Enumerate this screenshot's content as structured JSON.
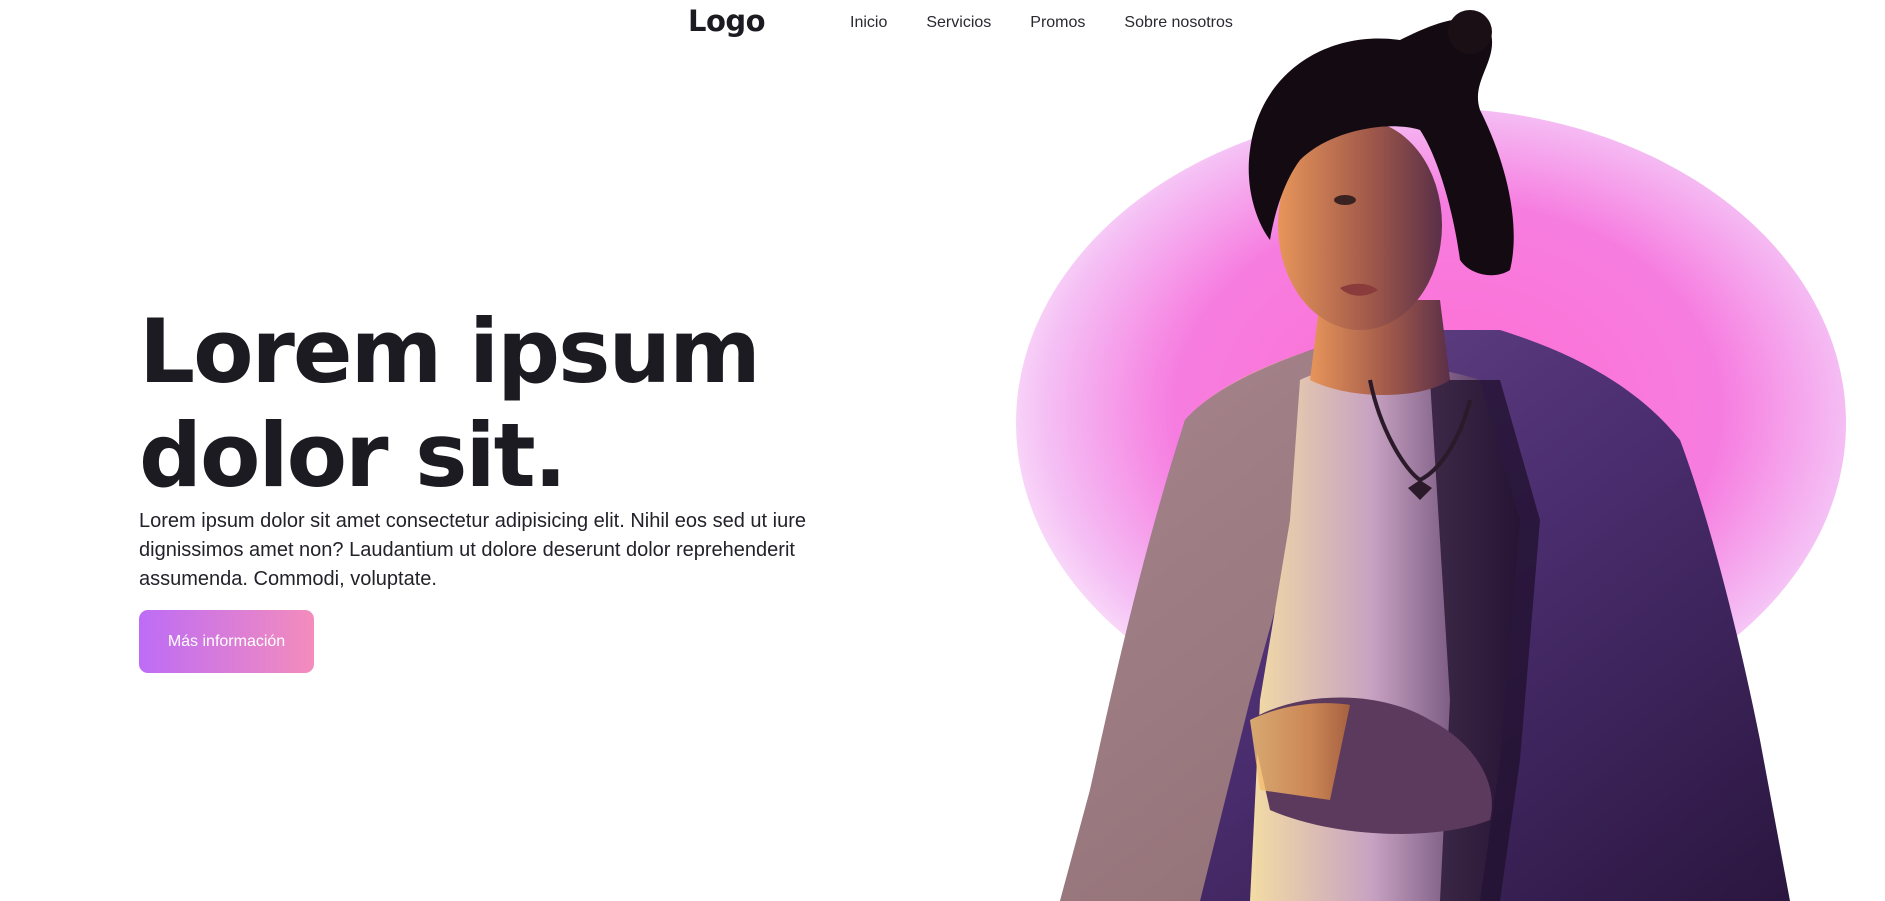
{
  "header": {
    "logo": "Logo",
    "nav": [
      {
        "label": "Inicio"
      },
      {
        "label": "Servicios"
      },
      {
        "label": "Promos"
      },
      {
        "label": "Sobre nosotros"
      }
    ]
  },
  "hero": {
    "title_line1": "Lorem ipsum",
    "title_line2": "dolor sit.",
    "text": "Lorem ipsum dolor sit amet consectetur adipisicing elit. Nihil eos sed ut iure dignissimos amet non? Laudantium ut dolore deserunt dolor reprehenderit assumenda. Commodi, voluptate.",
    "button_label": "Más información"
  },
  "colors": {
    "text": "#1d1b22",
    "button_gradient_start": "#bd6cf6",
    "button_gradient_end": "#f48cbc",
    "glow": "#ff6ed2"
  },
  "image": {
    "description_icon": "person-photo"
  }
}
